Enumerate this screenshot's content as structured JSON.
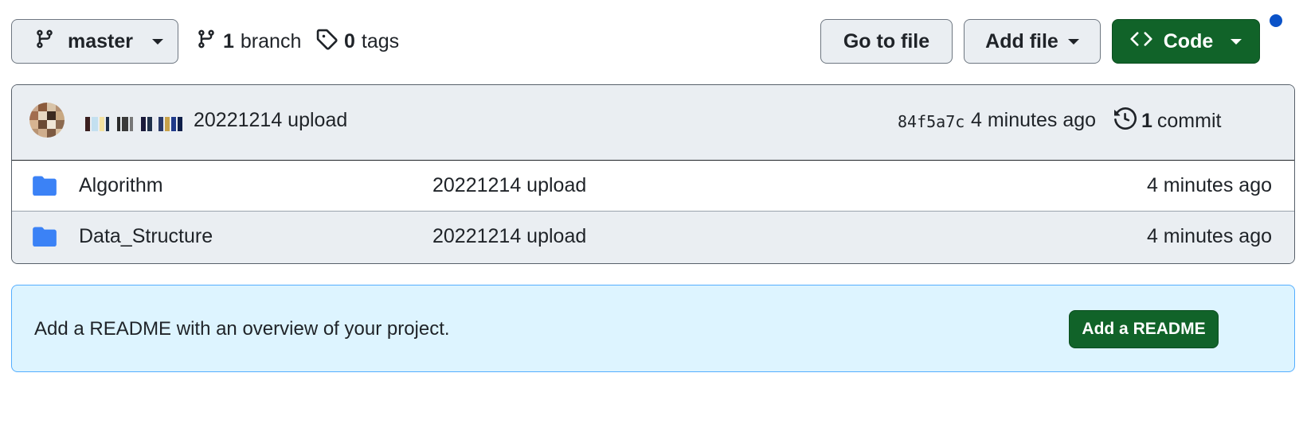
{
  "toolbar": {
    "branch_label": "master",
    "branches_count": "1",
    "branches_label": "branch",
    "tags_count": "0",
    "tags_label": "tags",
    "goto_file_label": "Go to file",
    "add_file_label": "Add file",
    "code_label": "Code"
  },
  "latest_commit": {
    "message": "20221214 upload",
    "sha": "84f5a7c",
    "time": "4 minutes ago",
    "commit_count": "1",
    "commit_label": "commit"
  },
  "files": [
    {
      "name": "Algorithm",
      "commit": "20221214 upload",
      "time": "4 minutes ago",
      "icon": "folder-icon"
    },
    {
      "name": "Data_Structure",
      "commit": "20221214 upload",
      "time": "4 minutes ago",
      "icon": "folder-icon"
    }
  ],
  "readme": {
    "message": "Add a README with an overview of your project.",
    "button_label": "Add a README"
  },
  "colors": {
    "primary_button": "#116329",
    "folder": "#3b82f6",
    "readme_bg": "#ddf4ff",
    "readme_border": "#54aeff",
    "notification_dot": "#0a52c8"
  }
}
